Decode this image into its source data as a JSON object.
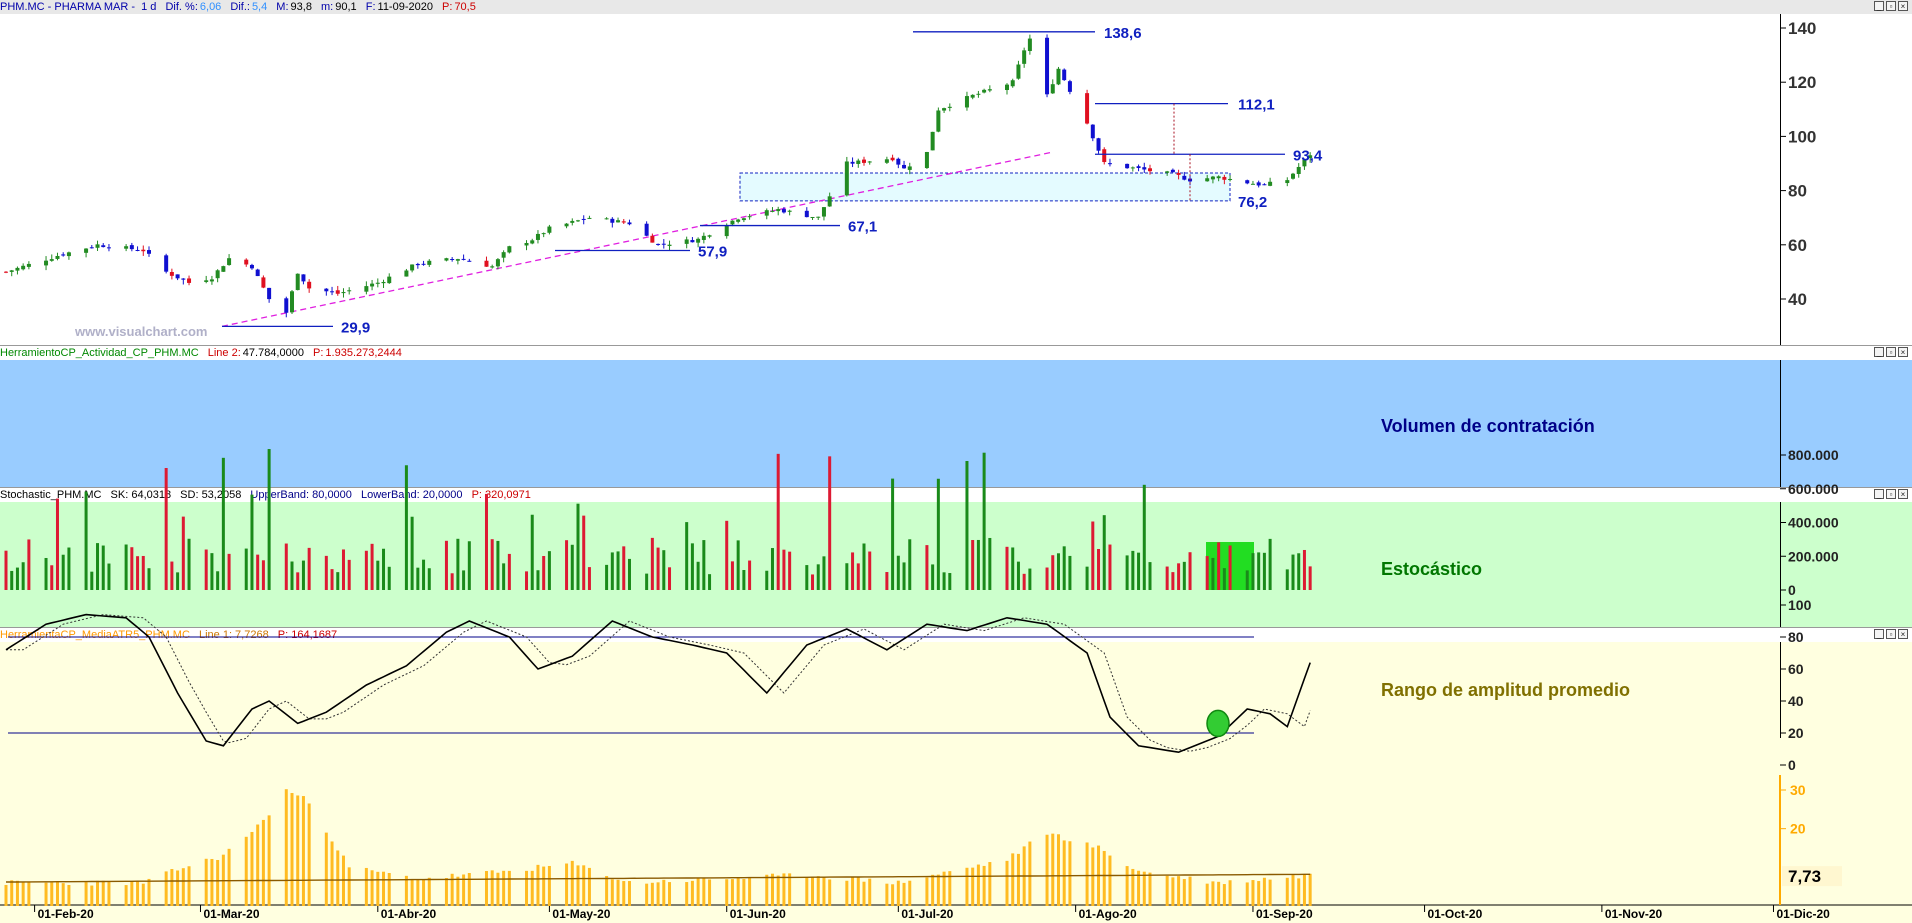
{
  "header": {
    "symbol": "PHM.MC - PHARMA MAR -",
    "period": "1 d",
    "dif_pct_label": "Dif. %:",
    "dif_pct_value": "6,06",
    "dif_label": "Dif.:",
    "dif_value": "5,4",
    "max_label": "M:",
    "max_value": "93,8",
    "min_label": "m:",
    "min_value": "90,1",
    "date_label": "F:",
    "date_value": "11-09-2020",
    "p_label": "P:",
    "p_value": "70,5"
  },
  "watermark": "www.visualchart.com",
  "panes": {
    "volume": {
      "indicator": "HerramientoCP_Actividad_CP_PHM.MC",
      "line_label": "Line 2:",
      "line_value": "47.784,0000",
      "p_label": "P:",
      "p_value": "1.935.273,2444",
      "title": "Volumen de contratación"
    },
    "stoch": {
      "indicator": "Stochastic_PHM.MC",
      "sk": "SK: 64,0318",
      "sd": "SD: 53,2058",
      "upper": "UpperBand: 80,0000",
      "lower": "LowerBand: 20,0000",
      "p": "P: 320,0971",
      "title": "Estocástico"
    },
    "atr": {
      "indicator": "HerramientaCP_MediaATR5_PHM.MC",
      "line": "Line 1: 7,7268",
      "p": "P: 164,1687",
      "title": "Rango de amplitud promedio",
      "last_value": "7,73"
    }
  },
  "x_axis": [
    "01-Feb-20",
    "01-Mar-20",
    "01-Abr-20",
    "01-May-20",
    "01-Jun-20",
    "01-Jul-20",
    "01-Ago-20",
    "01-Sep-20",
    "01-Oct-20",
    "01-Nov-20",
    "01-Dic-20"
  ],
  "price_axis": [
    "140",
    "120",
    "100",
    "80",
    "60",
    "40"
  ],
  "volume_axis": [
    "800.000",
    "600.000",
    "400.000",
    "200.000",
    "0"
  ],
  "stoch_axis": [
    "100",
    "80",
    "60",
    "40",
    "20",
    "0"
  ],
  "atr_axis": [
    "30",
    "20"
  ],
  "annotations": [
    "138,6",
    "112,1",
    "93,4",
    "76,2",
    "67,1",
    "57,9",
    "29,9"
  ],
  "colors": {
    "up": "#228b22",
    "down_blue": "#1010d0",
    "down_red": "#e01020",
    "level": "#1020c0",
    "trend": "#e020e0",
    "volume_bg": "#99ccff",
    "stoch_bg": "#ccffcc",
    "atr_bg": "#ffffe0",
    "atr_bar": "#ffbb22",
    "highlight": "#22dd22"
  },
  "chart_data": [
    {
      "type": "candlestick",
      "title": "PHM.MC - PHARMA MAR",
      "x_range": [
        "2020-01-27",
        "2020-12-31"
      ],
      "ylim": [
        22,
        145
      ],
      "key_levels": [
        138.6,
        112.1,
        93.4,
        76.2,
        67.1,
        57.9,
        29.9
      ],
      "close_path": [
        [
          "2020-01-27",
          50
        ],
        [
          "2020-02-05",
          56
        ],
        [
          "2020-02-12",
          60
        ],
        [
          "2020-02-20",
          58
        ],
        [
          "2020-02-24",
          50
        ],
        [
          "2020-02-28",
          46
        ],
        [
          "2020-03-03",
          48
        ],
        [
          "2020-03-06",
          55
        ],
        [
          "2020-03-10",
          52
        ],
        [
          "2020-03-13",
          40
        ],
        [
          "2020-03-16",
          35
        ],
        [
          "2020-03-18",
          50
        ],
        [
          "2020-03-20",
          44
        ],
        [
          "2020-03-25",
          42
        ],
        [
          "2020-04-01",
          46
        ],
        [
          "2020-04-08",
          53
        ],
        [
          "2020-04-15",
          55
        ],
        [
          "2020-04-21",
          52
        ],
        [
          "2020-04-24",
          59
        ],
        [
          "2020-04-28",
          62
        ],
        [
          "2020-05-01",
          66
        ],
        [
          "2020-05-08",
          70
        ],
        [
          "2020-05-15",
          68
        ],
        [
          "2020-05-20",
          60
        ],
        [
          "2020-05-27",
          62
        ],
        [
          "2020-06-03",
          70
        ],
        [
          "2020-06-10",
          73
        ],
        [
          "2020-06-17",
          70
        ],
        [
          "2020-06-19",
          78
        ],
        [
          "2020-06-22",
          90
        ],
        [
          "2020-06-30",
          92
        ],
        [
          "2020-07-02",
          88
        ],
        [
          "2020-07-06",
          94
        ],
        [
          "2020-07-08",
          110
        ],
        [
          "2020-07-14",
          115
        ],
        [
          "2020-07-21",
          120
        ],
        [
          "2020-07-23",
          132
        ],
        [
          "2020-07-24",
          136
        ],
        [
          "2020-07-27",
          115
        ],
        [
          "2020-07-29",
          125
        ],
        [
          "2020-08-03",
          105
        ],
        [
          "2020-08-06",
          90
        ],
        [
          "2020-08-12",
          88
        ],
        [
          "2020-08-18",
          86
        ],
        [
          "2020-08-21",
          84
        ],
        [
          "2020-08-26",
          85
        ],
        [
          "2020-08-31",
          83
        ],
        [
          "2020-09-03",
          82
        ],
        [
          "2020-09-07",
          84
        ],
        [
          "2020-09-11",
          93.4
        ]
      ]
    },
    {
      "type": "bar",
      "title": "Volumen de contratación",
      "ylim": [
        0,
        900000
      ],
      "note": "daily volume, green = up day, red = down day",
      "highlighted_range": [
        "2020-09-01",
        "2020-09-11"
      ]
    },
    {
      "type": "line",
      "title": "Estocástico",
      "ylim": [
        0,
        100
      ],
      "bands": [
        80,
        20
      ],
      "sk_last": 64.0318,
      "sd_last": 53.2058,
      "sk_path": [
        [
          "2020-01-27",
          72
        ],
        [
          "2020-02-03",
          88
        ],
        [
          "2020-02-10",
          94
        ],
        [
          "2020-02-17",
          92
        ],
        [
          "2020-02-21",
          80
        ],
        [
          "2020-02-26",
          45
        ],
        [
          "2020-03-02",
          15
        ],
        [
          "2020-03-05",
          12
        ],
        [
          "2020-03-10",
          35
        ],
        [
          "2020-03-13",
          40
        ],
        [
          "2020-03-18",
          26
        ],
        [
          "2020-03-23",
          33
        ],
        [
          "2020-03-30",
          50
        ],
        [
          "2020-04-06",
          62
        ],
        [
          "2020-04-13",
          83
        ],
        [
          "2020-04-17",
          90
        ],
        [
          "2020-04-24",
          80
        ],
        [
          "2020-04-29",
          60
        ],
        [
          "2020-05-05",
          68
        ],
        [
          "2020-05-12",
          90
        ],
        [
          "2020-05-19",
          80
        ],
        [
          "2020-05-26",
          75
        ],
        [
          "2020-06-01",
          70
        ],
        [
          "2020-06-08",
          45
        ],
        [
          "2020-06-15",
          75
        ],
        [
          "2020-06-22",
          85
        ],
        [
          "2020-06-29",
          72
        ],
        [
          "2020-07-06",
          88
        ],
        [
          "2020-07-13",
          84
        ],
        [
          "2020-07-20",
          92
        ],
        [
          "2020-07-27",
          88
        ],
        [
          "2020-08-03",
          70
        ],
        [
          "2020-08-07",
          30
        ],
        [
          "2020-08-12",
          12
        ],
        [
          "2020-08-19",
          8
        ],
        [
          "2020-08-26",
          18
        ],
        [
          "2020-08-31",
          35
        ],
        [
          "2020-09-04",
          32
        ],
        [
          "2020-09-07",
          24
        ],
        [
          "2020-09-11",
          64
        ]
      ]
    },
    {
      "type": "bar",
      "title": "Rango de amplitud promedio",
      "ylim": [
        0,
        32
      ],
      "last_value": 7.73,
      "peaks": [
        [
          "2020-03-16",
          30
        ],
        [
          "2020-07-27",
          19
        ]
      ]
    }
  ]
}
